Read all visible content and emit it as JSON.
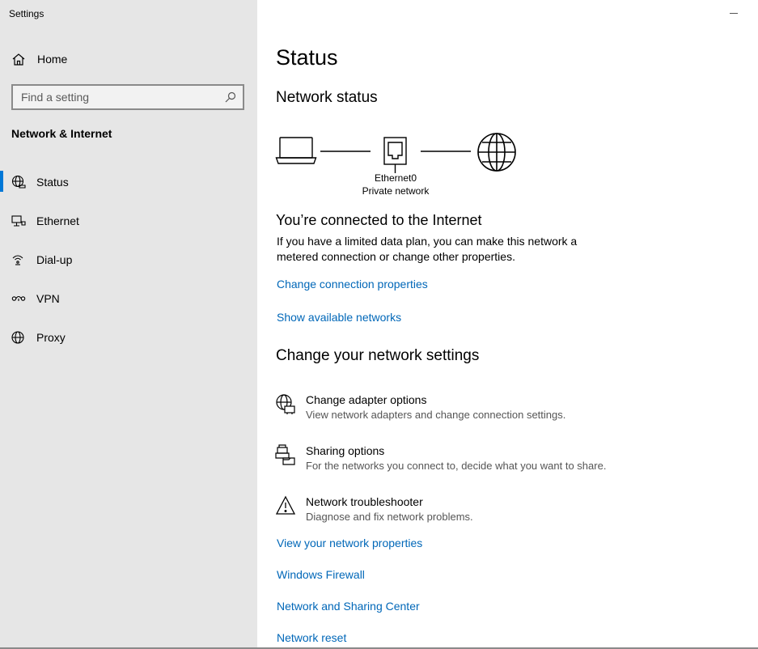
{
  "app": {
    "title": "Settings"
  },
  "sidebar": {
    "home_label": "Home",
    "search_placeholder": "Find a setting",
    "section_title": "Network & Internet",
    "items": [
      {
        "label": "Status",
        "icon": "globe-status-icon",
        "active": true
      },
      {
        "label": "Ethernet",
        "icon": "ethernet-icon",
        "active": false
      },
      {
        "label": "Dial-up",
        "icon": "dialup-icon",
        "active": false
      },
      {
        "label": "VPN",
        "icon": "vpn-icon",
        "active": false
      },
      {
        "label": "Proxy",
        "icon": "globe-icon",
        "active": false
      }
    ]
  },
  "main": {
    "title": "Status",
    "network_status_heading": "Network status",
    "diagram": {
      "device_icon": "laptop-icon",
      "adapter_icon": "ethernet-port-icon",
      "internet_icon": "globe-icon",
      "adapter_name": "Ethernet0",
      "network_type": "Private network"
    },
    "connected_heading": "You’re connected to the Internet",
    "connected_text": "If you have a limited data plan, you can make this network a metered connection or change other properties.",
    "link_change_connection": "Change connection properties",
    "link_show_networks": "Show available networks",
    "change_settings_heading": "Change your network settings",
    "options": [
      {
        "title": "Change adapter options",
        "desc": "View network adapters and change connection settings.",
        "icon": "adapter-icon"
      },
      {
        "title": "Sharing options",
        "desc": "For the networks you connect to, decide what you want to share.",
        "icon": "sharing-icon"
      },
      {
        "title": "Network troubleshooter",
        "desc": "Diagnose and fix network problems.",
        "icon": "warning-icon"
      }
    ],
    "links": [
      "View your network properties",
      "Windows Firewall",
      "Network and Sharing Center",
      "Network reset"
    ]
  },
  "colors": {
    "accent": "#0078d7",
    "link": "#0067b8",
    "sidebar_bg": "#e6e6e6"
  }
}
